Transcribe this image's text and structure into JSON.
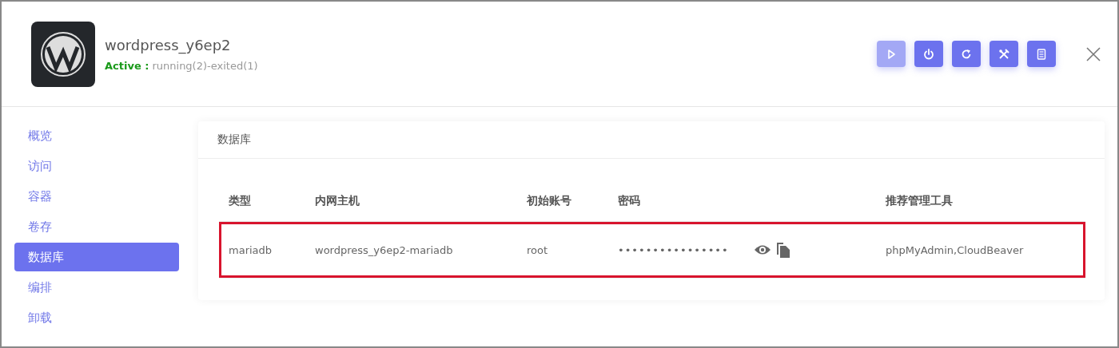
{
  "app": {
    "name": "wordpress_y6ep2",
    "status_label": "Active :",
    "status_detail": "running(2)-exited(1)"
  },
  "toolbar": [
    {
      "kind": "start",
      "disabled": true
    },
    {
      "kind": "stop",
      "disabled": false
    },
    {
      "kind": "restart",
      "disabled": false
    },
    {
      "kind": "tools",
      "disabled": false
    },
    {
      "kind": "logs",
      "disabled": false
    }
  ],
  "sidebar": {
    "items": [
      {
        "label": "概览",
        "selected": false
      },
      {
        "label": "访问",
        "selected": false
      },
      {
        "label": "容器",
        "selected": false
      },
      {
        "label": "卷存",
        "selected": false
      },
      {
        "label": "数据库",
        "selected": true
      },
      {
        "label": "编排",
        "selected": false
      },
      {
        "label": "卸载",
        "selected": false
      }
    ]
  },
  "panel": {
    "title": "数据库",
    "table": {
      "columns": [
        "类型",
        "内网主机",
        "初始账号",
        "密码",
        "推荐管理工具"
      ],
      "rows": [
        {
          "type": "mariadb",
          "host": "wordpress_y6ep2-mariadb",
          "account": "root",
          "password": "••••••••••••••••",
          "tools": "phpMyAdmin,CloudBeaver",
          "highlighted": true
        }
      ]
    }
  }
}
